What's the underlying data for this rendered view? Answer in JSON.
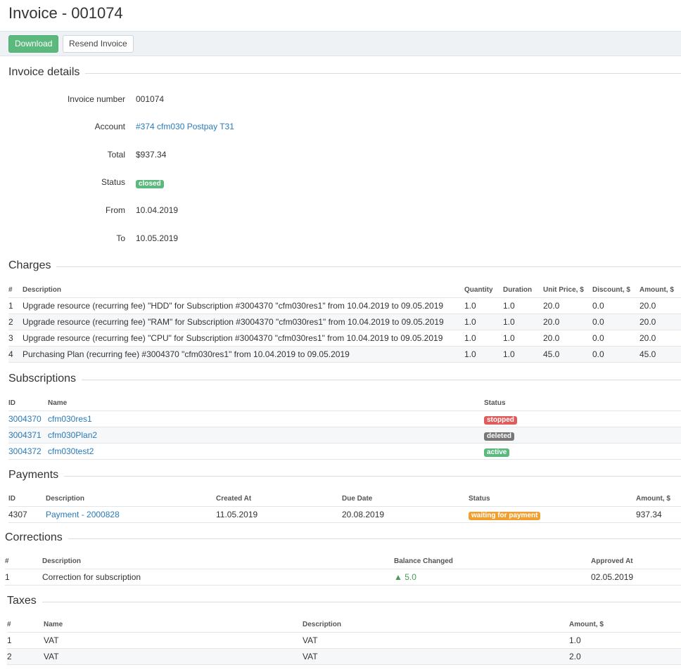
{
  "page": {
    "title": "Invoice - 001074"
  },
  "toolbar": {
    "download": "Download",
    "resend": "Resend Invoice"
  },
  "sections": {
    "details": "Invoice details",
    "charges": "Charges",
    "subscriptions": "Subscriptions",
    "payments": "Payments",
    "corrections": "Corrections",
    "taxes": "Taxes"
  },
  "details": {
    "invoice_number_label": "Invoice number",
    "invoice_number": "001074",
    "account_label": "Account",
    "account": "#374 cfm030 Postpay T31",
    "total_label": "Total",
    "total": "$937.34",
    "status_label": "Status",
    "status": "closed",
    "from_label": "From",
    "from": "10.04.2019",
    "to_label": "To",
    "to": "10.05.2019"
  },
  "charges": {
    "headers": [
      "#",
      "Description",
      "Quantity",
      "Duration",
      "Unit Price, $",
      "Discount, $",
      "Amount, $"
    ],
    "rows": [
      [
        "1",
        "Upgrade resource (recurring fee) \"HDD\" for Subscription #3004370 \"cfm030res1\" from 10.04.2019 to 09.05.2019",
        "1.0",
        "1.0",
        "20.0",
        "0.0",
        "20.0"
      ],
      [
        "2",
        "Upgrade resource (recurring fee) \"RAM\" for Subscription #3004370 \"cfm030res1\" from 10.04.2019 to 09.05.2019",
        "1.0",
        "1.0",
        "20.0",
        "0.0",
        "20.0"
      ],
      [
        "3",
        "Upgrade resource (recurring fee) \"CPU\" for Subscription #3004370 \"cfm030res1\" from 10.04.2019 to 09.05.2019",
        "1.0",
        "1.0",
        "20.0",
        "0.0",
        "20.0"
      ],
      [
        "4",
        "Purchasing Plan (recurring fee) #3004370 \"cfm030res1\" from 10.04.2019 to 09.05.2019",
        "1.0",
        "1.0",
        "45.0",
        "0.0",
        "45.0"
      ]
    ]
  },
  "subscriptions": {
    "headers": [
      "ID",
      "Name",
      "Status"
    ],
    "rows": [
      [
        "3004370",
        "cfm030res1",
        "stopped"
      ],
      [
        "3004371",
        "cfm030Plan2",
        "deleted"
      ],
      [
        "3004372",
        "cfm030test2",
        "active"
      ]
    ]
  },
  "payments": {
    "headers": [
      "ID",
      "Description",
      "Created At",
      "Due Date",
      "Status",
      "Amount, $"
    ],
    "rows": [
      [
        "4307",
        "Payment - 2000828",
        "11.05.2019",
        "20.08.2019",
        "waiting for payment",
        "937.34"
      ]
    ]
  },
  "corrections": {
    "headers": [
      "#",
      "Description",
      "Balance Changed",
      "Approved At"
    ],
    "rows": [
      [
        "1",
        "Correction for subscription",
        "▲ 5.0",
        "02.05.2019"
      ]
    ]
  },
  "taxes": {
    "headers": [
      "#",
      "Name",
      "Description",
      "Amount, $"
    ],
    "rows": [
      [
        "1",
        "VAT",
        "VAT",
        "1.0"
      ],
      [
        "2",
        "VAT",
        "VAT",
        "2.0"
      ]
    ]
  },
  "colors": {
    "status_closed": "#5cb97e",
    "status_stopped": "#e05c5c",
    "status_deleted": "#777777",
    "status_active": "#5cb97e",
    "status_waiting": "#f0a030",
    "link": "#2a7ab9",
    "download_button": "#5cb97e"
  }
}
